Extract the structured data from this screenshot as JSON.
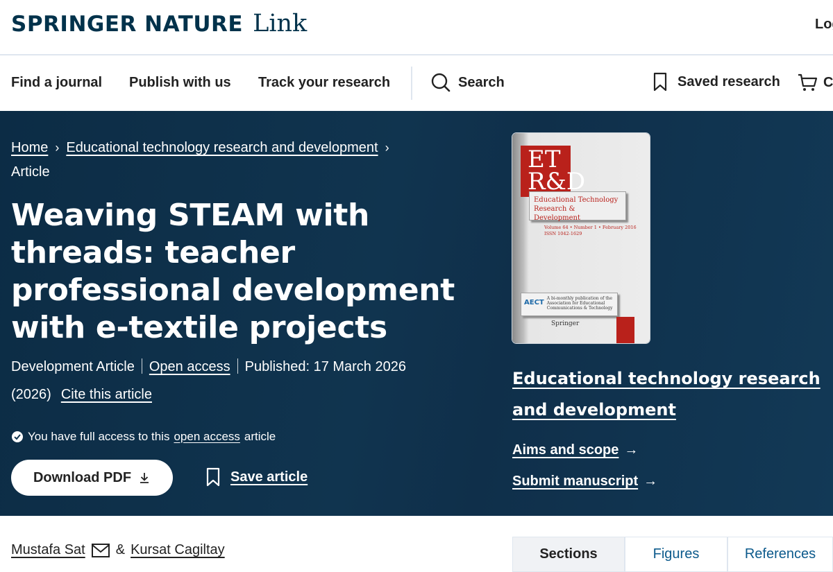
{
  "header": {
    "brand": "SPRINGER NATURE",
    "brand_suffix": "Link",
    "login": "Log"
  },
  "nav": {
    "find_journal": "Find a journal",
    "publish": "Publish with us",
    "track": "Track your research",
    "search": "Search",
    "saved": "Saved research",
    "cart": "C"
  },
  "breadcrumb": {
    "home": "Home",
    "journal": "Educational technology research and development",
    "current": "Article"
  },
  "article": {
    "title": "Weaving STEAM with threads: teacher professional development with e-textile projects",
    "type": "Development Article",
    "open_access": "Open access",
    "published": "Published: 17 March 2026",
    "year": "(2026)",
    "cite": "Cite this article",
    "access_prefix": "You have full access to this",
    "access_link": "open access",
    "access_suffix": "article",
    "download_pdf": "Download PDF",
    "save": "Save article"
  },
  "cover": {
    "logo": "ET R&D",
    "name_line1": "Educational Technology",
    "name_line2": "Research & Development",
    "volume": "Volume 64 • Number 1 • February 2016",
    "issn": "ISSN 1042-1629",
    "aect_mark": "AECT",
    "aect_text": "A bi-monthly publication of the Association for Educational Communications & Technology",
    "publisher": "Springer"
  },
  "journal": {
    "title": "Educational technology research and development",
    "aims": "Aims and scope",
    "submit": "Submit manuscript"
  },
  "authors": {
    "first": "Mustafa Sat",
    "and": "&",
    "second": "Kursat Cagiltay"
  },
  "tabs": [
    "Sections",
    "Figures",
    "References"
  ],
  "icons": {
    "search": "search-icon",
    "bookmark": "bookmark-icon",
    "cart": "cart-icon",
    "chevron": "chevron-right-icon",
    "check": "check-circle-icon",
    "download": "download-icon",
    "arrow": "arrow-right-icon",
    "mail": "mail-icon"
  },
  "colors": {
    "brand": "#01324b",
    "hero_bg": "#10344f",
    "link_blue": "#0c5a8c",
    "cover_red": "#b9211b"
  }
}
